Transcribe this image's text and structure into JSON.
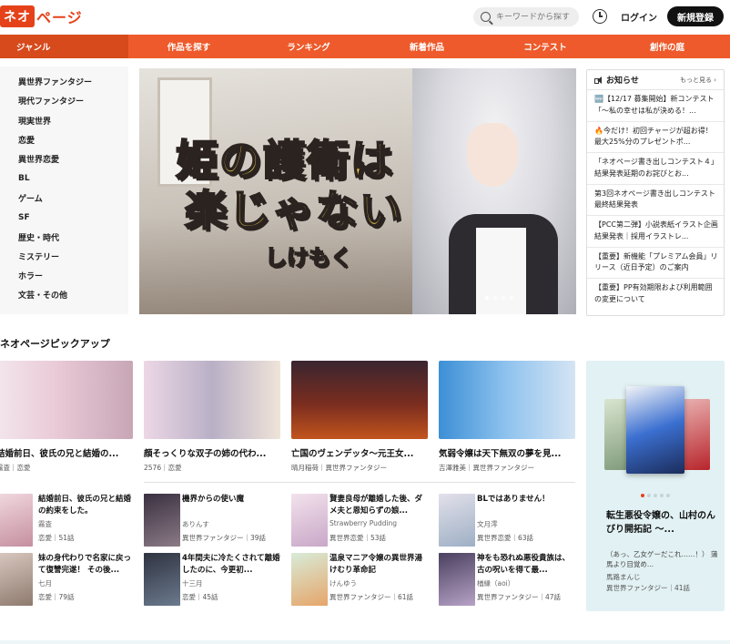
{
  "header": {
    "logo_box": "ネオ",
    "logo_text": "ページ",
    "search_placeholder": "キーワードから探す",
    "login_label": "ログイン",
    "register_label": "新規登録"
  },
  "nav": [
    "ジャンル",
    "作品を探す",
    "ランキング",
    "新着作品",
    "コンテスト",
    "創作の庭"
  ],
  "sidebar": [
    "異世界ファンタジー",
    "現代ファンタジー",
    "現実世界",
    "恋愛",
    "異世界恋愛",
    "BL",
    "ゲーム",
    "SF",
    "歴史・時代",
    "ミステリー",
    "ホラー",
    "文芸・その他"
  ],
  "banner": {
    "title_line1": "姫の護衛は",
    "title_line2": "楽じゃない",
    "author": "しけもく"
  },
  "notices": {
    "title": "お知らせ",
    "more": "もっと見る ›",
    "items": [
      "🆕【12/17 募集開始】新コンテスト「〜私の幸せは私が決める！...",
      "🔥今だけ！初回チャージが超お得！最大25%分のプレゼントポ...",
      "「ネオページ書き出しコンテスト４」結果発表延期のお詫びとお...",
      "第3回ネオページ書き出しコンテスト最終結果発表",
      "【PCC第二弾】小説表紙イラスト企画結果発表｜採用イラストレ...",
      "【重要】新機能「プレミアム会員」リリース（近日予定）のご案内",
      "【重要】PP有効期限および利用範囲の変更について"
    ]
  },
  "pickup": {
    "title": "ネオページピックアップ",
    "cards": [
      {
        "title": "結婚前日、彼氏の兄と結婚の...",
        "meta": "霧査｜恋愛"
      },
      {
        "title": "顔そっくりな双子の姉の代わ...",
        "meta": "2576｜恋愛"
      },
      {
        "title": "亡国のヴェンデッタ〜元王女...",
        "meta": "晴月稲荷｜異世界ファンタジー"
      },
      {
        "title": "気弱令嬢は天下無双の夢を見...",
        "meta": "吉澤雅美｜異世界ファンタジー"
      }
    ],
    "rows": [
      {
        "title": "結婚前日、彼氏の兄と結婚の約束をした。",
        "author": "霧査",
        "meta": "恋愛｜51話"
      },
      {
        "title": "機界からの使い魔",
        "author": "ありんす",
        "meta": "異世界ファンタジー｜39話"
      },
      {
        "title": "賢妻良母が離婚した後、ダメ夫と恩知らずの娘...",
        "author": "Strawberry Pudding",
        "meta": "異世界恋愛｜53話"
      },
      {
        "title": "BLではありません！",
        "author": "文月澪",
        "meta": "異世界恋愛｜63話"
      },
      {
        "title": "妹の身代わりで名家に戻って復讐完遂！ その後...",
        "author": "七月",
        "meta": "恋愛｜79話"
      },
      {
        "title": "4年間夫に冷たくされて離婚したのに、今更初...",
        "author": "十三月",
        "meta": "恋愛｜45話"
      },
      {
        "title": "温泉マニア令嬢の異世界湯けむり革命記",
        "author": "けんゆう",
        "meta": "異世界ファンタジー｜61話"
      },
      {
        "title": "神をも恐れぬ悪役貴族は、古の呪いを得て最...",
        "author": "楢縁（aoi）",
        "meta": "異世界ファンタジー｜47話"
      }
    ]
  },
  "featured": {
    "title": "転生悪役令嬢の、山村のんびり開拓記 〜...",
    "desc": "（あっ、乙女ゲーだこれ……！） 蒲馬より目覚め...",
    "author": "馬路まんじ",
    "meta": "異世界ファンタジー｜41話"
  },
  "colors": {
    "brand": "#e5421a",
    "nav": "#ee5a2b",
    "nav_active": "#d64a1c"
  }
}
